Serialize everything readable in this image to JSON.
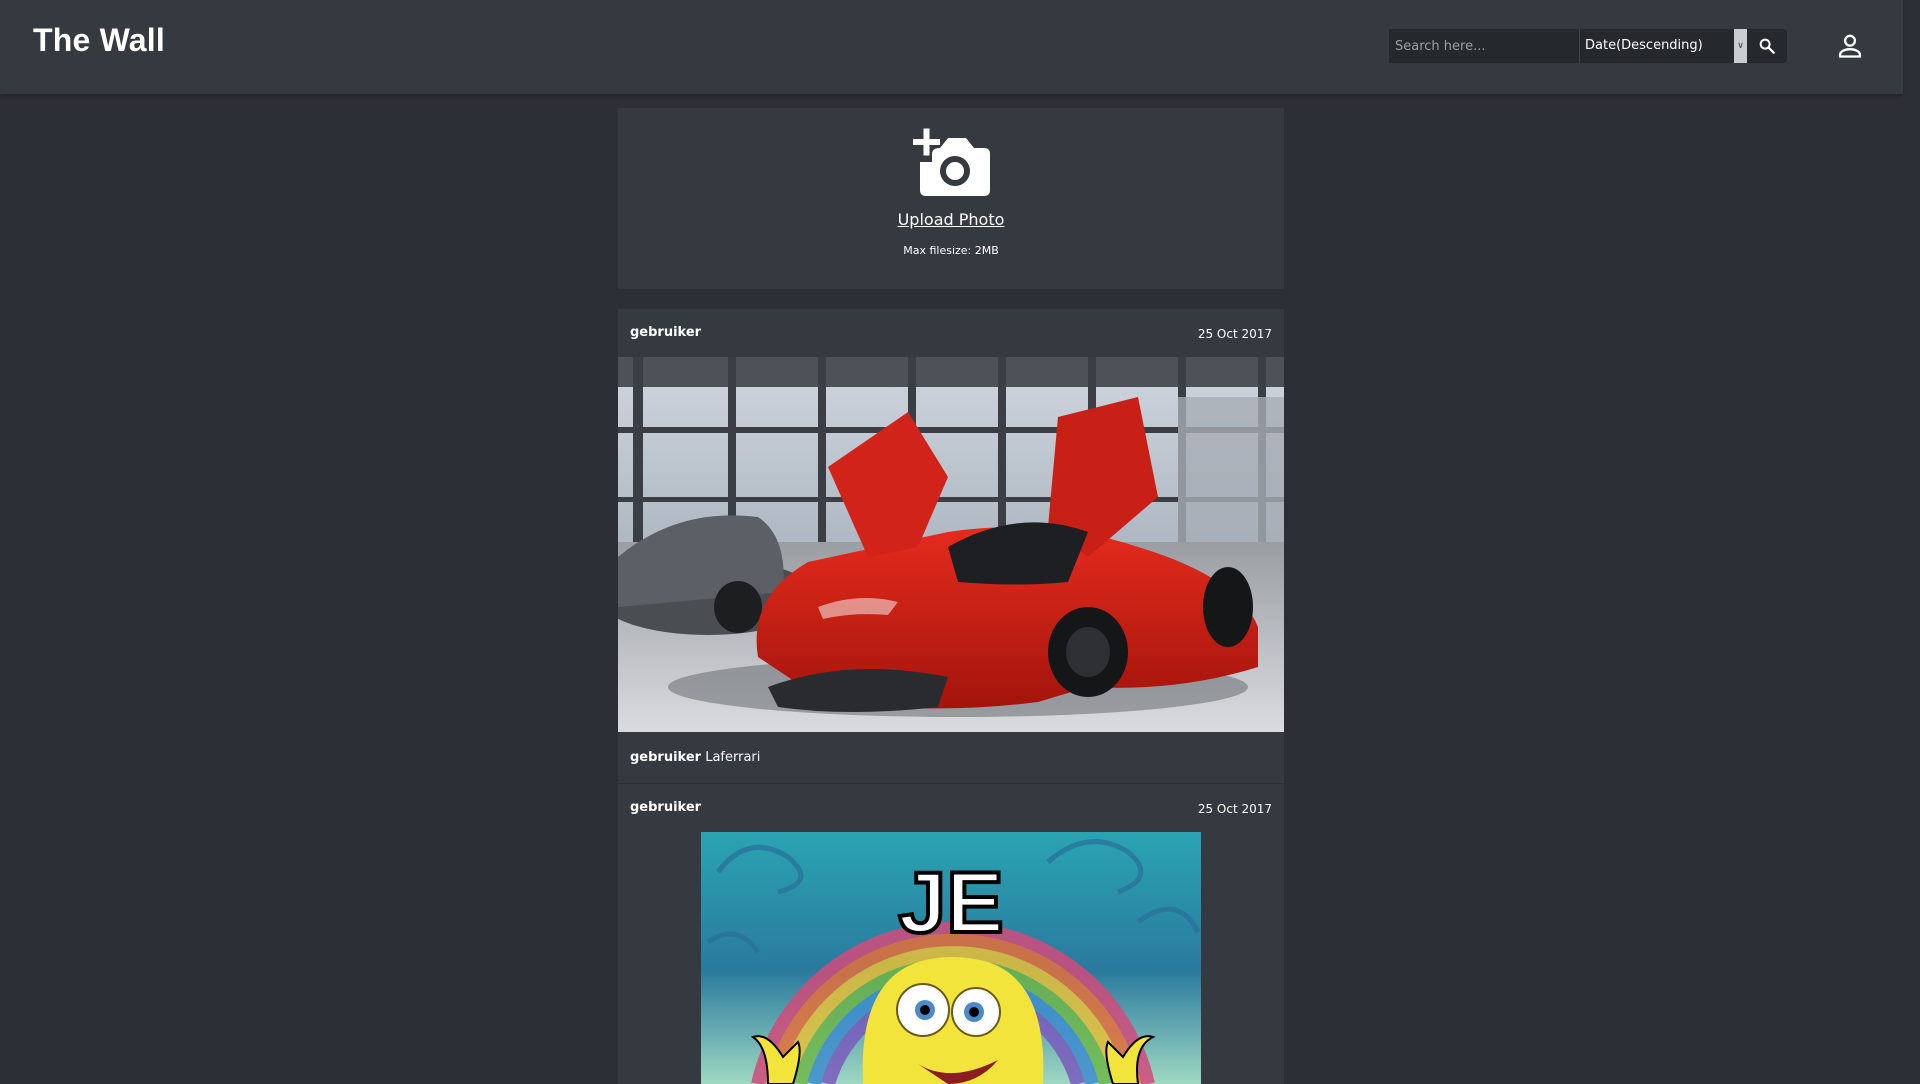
{
  "header": {
    "title": "The Wall",
    "search_placeholder": "Search here...",
    "sort_value": "Date(Descending)"
  },
  "upload": {
    "label": "Upload Photo",
    "hint": "Max filesize: 2MB"
  },
  "posts": [
    {
      "author": "gebruiker",
      "date": "25 Oct 2017",
      "caption_author": "gebruiker",
      "caption": "Laferrari",
      "image_description": "red-sports-car-photo"
    },
    {
      "author": "gebruiker",
      "date": "25 Oct 2017",
      "image_text": "JE",
      "image_description": "spongebob-rainbow-meme"
    }
  ],
  "colors": {
    "background": "#2c2f35",
    "header": "#353940",
    "card": "#353940",
    "input": "#25282d"
  }
}
